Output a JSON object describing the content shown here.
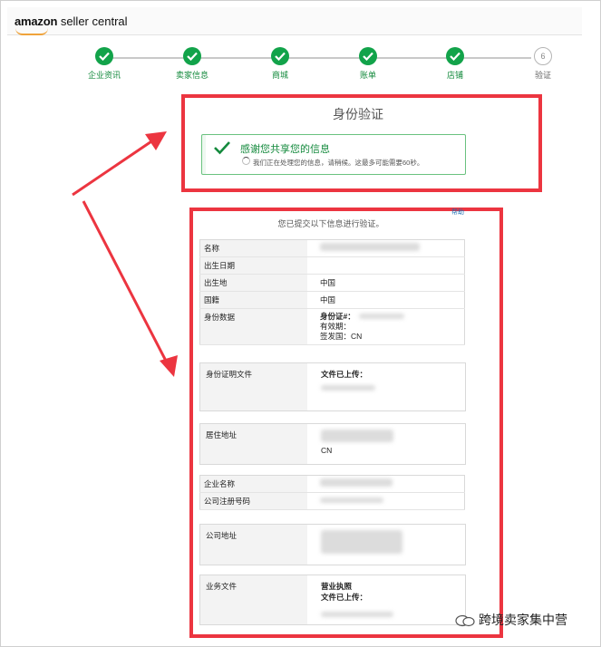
{
  "header": {
    "brand": "amazon",
    "product": " seller central"
  },
  "stepper": {
    "steps": [
      {
        "label": "企业资讯",
        "state": "done"
      },
      {
        "label": "卖家信息",
        "state": "done"
      },
      {
        "label": "商城",
        "state": "done"
      },
      {
        "label": "账单",
        "state": "done"
      },
      {
        "label": "店铺",
        "state": "done"
      },
      {
        "label": "验证",
        "state": "pending",
        "number": "6"
      }
    ]
  },
  "verification": {
    "title": "身份验证",
    "notice_head": "感谢您共享您的信息",
    "notice_sub": "我们正在处理您的信息，请稍候。这最多可能需要60秒。",
    "help": "帮助",
    "intro": "您已提交以下信息进行验证。"
  },
  "fields": {
    "name": "名称",
    "dob": "出生日期",
    "birthplace": "出生地",
    "birthplace_value": "中国",
    "nationality": "国籍",
    "nationality_value": "中国",
    "id_data": "身份数据",
    "id_label": "身份证#：",
    "id_expiry": "有效期：",
    "id_country": "签发国：CN",
    "id_doc": "身份证明文件",
    "uploaded": "文件已上传：",
    "residence": "居住地址",
    "residence_country": "CN",
    "company_name": "企业名称",
    "company_reg": "公司注册号码",
    "company_address": "公司地址",
    "business_docs": "业务文件",
    "business_license": "营业执照",
    "business_uploaded": "文件已上传："
  },
  "watermark": "跨境卖家集中营",
  "colors": {
    "accent": "#12a34a",
    "annotation": "#ec3540"
  }
}
